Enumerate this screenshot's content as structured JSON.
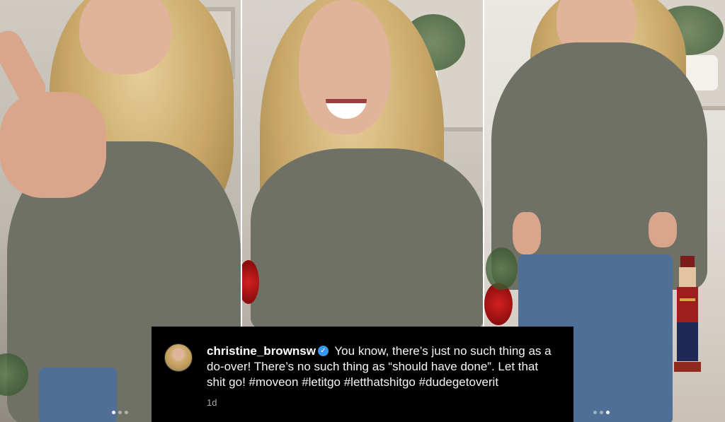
{
  "post": {
    "username": "christine_brownsw",
    "verified_icon": "verified-badge-icon",
    "caption": "You know, there’s just no such thing as a do-over! There’s no such thing as “should have done”. Let that shit go! #moveon #letitgo #letthatshitgo #dudegetoverit",
    "timestamp": "1d"
  },
  "carousel": {
    "panels": [
      {
        "name": "photo-pointing"
      },
      {
        "name": "photo-laughing"
      },
      {
        "name": "photo-dancing"
      }
    ],
    "slide_count": 3,
    "active_slide": 1
  },
  "colors": {
    "caption_background": "#000000",
    "verified_blue": "#3897f0",
    "timestamp_gray": "#a8a8a8"
  }
}
